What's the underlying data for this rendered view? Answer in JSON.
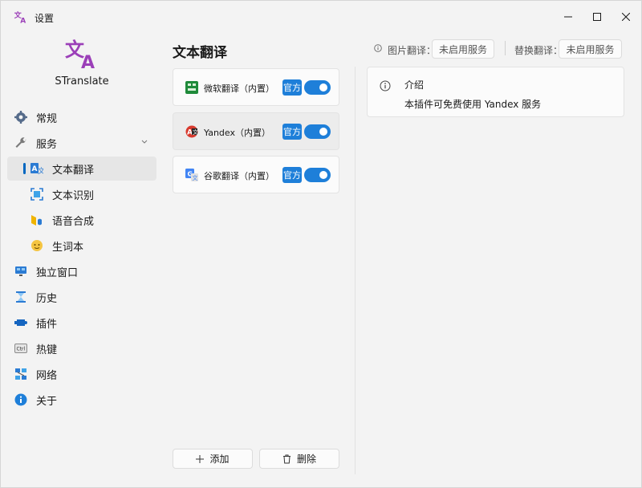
{
  "window": {
    "title": "设置"
  },
  "app": {
    "name": "STranslate"
  },
  "sidebar": {
    "items": [
      {
        "label": "常规",
        "icon": "gear-icon"
      },
      {
        "label": "服务",
        "icon": "wrench-icon",
        "expanded": true
      },
      {
        "label": "文本翻译",
        "icon": "translate-icon",
        "active": true
      },
      {
        "label": "文本识别",
        "icon": "scan-icon"
      },
      {
        "label": "语音合成",
        "icon": "voice-icon"
      },
      {
        "label": "生词本",
        "icon": "vocab-icon"
      },
      {
        "label": "独立窗口",
        "icon": "monitor-icon"
      },
      {
        "label": "历史",
        "icon": "hourglass-icon"
      },
      {
        "label": "插件",
        "icon": "plugin-icon"
      },
      {
        "label": "热键",
        "icon": "keyboard-icon"
      },
      {
        "label": "网络",
        "icon": "network-icon"
      },
      {
        "label": "关于",
        "icon": "info-icon"
      }
    ]
  },
  "main": {
    "title": "文本翻译",
    "image_translate_label": "图片翻译：",
    "image_translate_value": "未启用服务",
    "replace_translate_label": "替换翻译：",
    "replace_translate_value": "未启用服务"
  },
  "services": [
    {
      "name": "微软翻译（内置）",
      "badge": "官方",
      "enabled": true,
      "icon": "microsoft-translate-icon"
    },
    {
      "name": "Yandex（内置）",
      "badge": "官方",
      "enabled": true,
      "icon": "yandex-icon",
      "selected": true
    },
    {
      "name": "谷歌翻译（内置）",
      "badge": "官方",
      "enabled": true,
      "icon": "google-translate-icon"
    }
  ],
  "detail": {
    "title": "介绍",
    "text": "本插件可免费使用 Yandex 服务"
  },
  "buttons": {
    "add": "添加",
    "delete": "删除"
  },
  "colors": {
    "accent": "#1e7fd9",
    "logo": "#9b3fb8"
  }
}
